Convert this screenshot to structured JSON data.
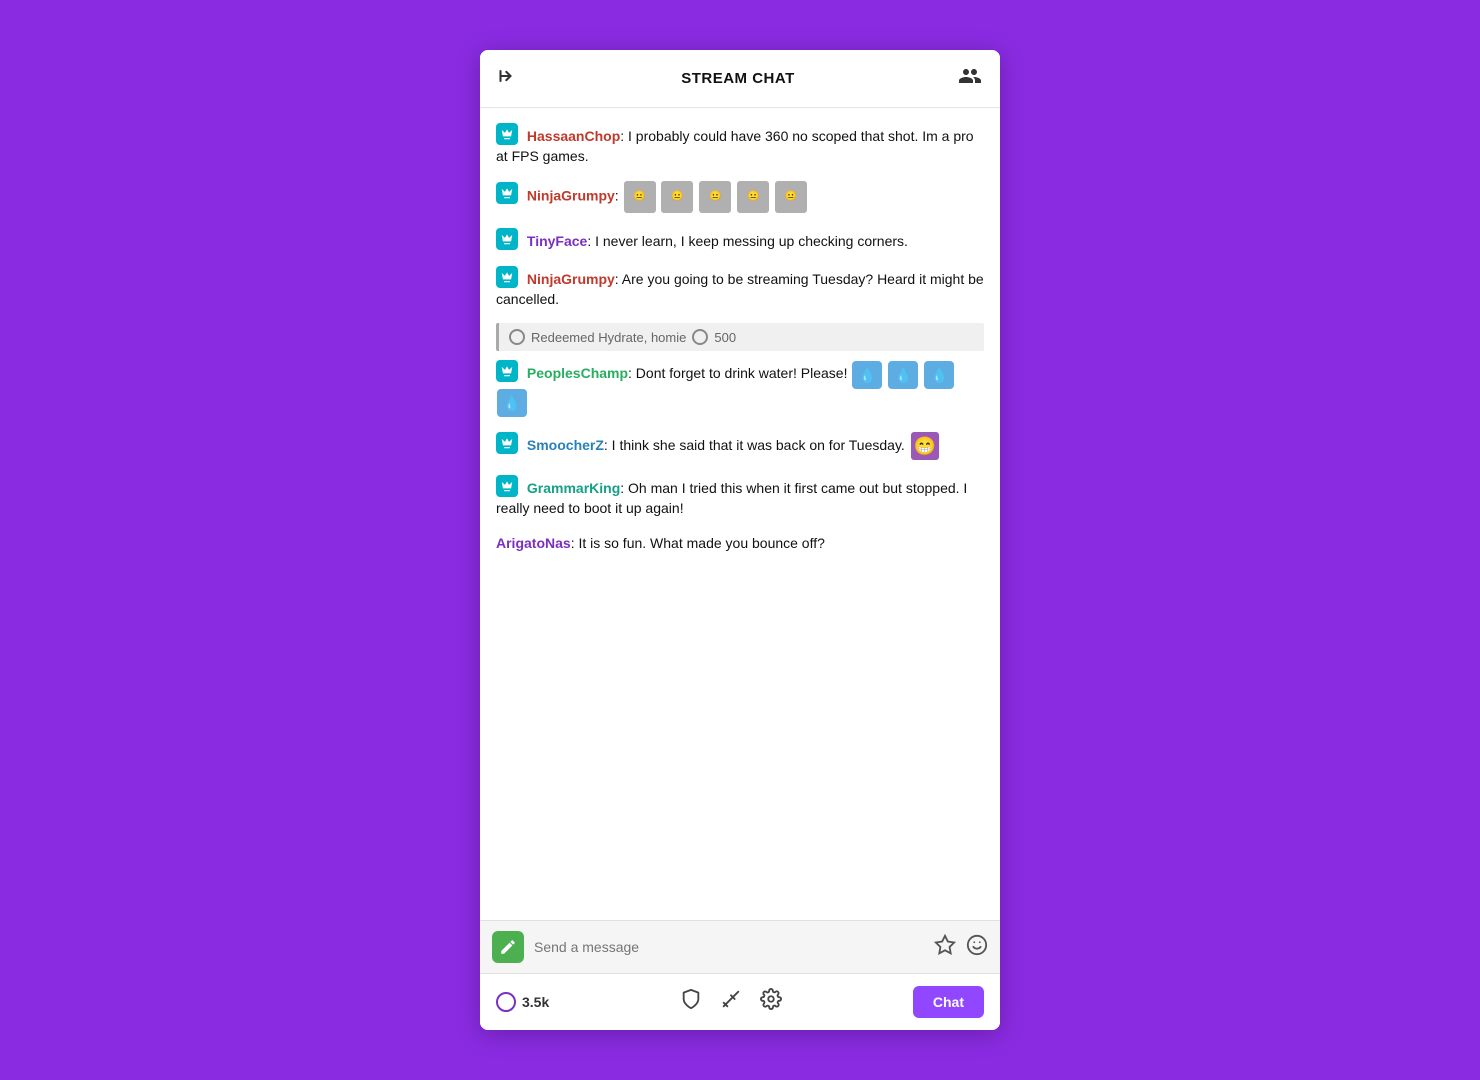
{
  "header": {
    "title": "STREAM CHAT",
    "collapse_label": "collapse",
    "users_label": "users"
  },
  "messages": [
    {
      "id": "msg1",
      "username": "HassaanChop",
      "username_color": "red",
      "has_badge": true,
      "text": ": I probably could have 360 no scoped that shot. Im a pro at FPS games."
    },
    {
      "id": "msg2",
      "username": "NinjaGrumpy",
      "username_color": "red",
      "has_badge": true,
      "text": ":",
      "has_emotes": true,
      "emote_type": "faces"
    },
    {
      "id": "msg3",
      "username": "TinyFace",
      "username_color": "purple",
      "has_badge": true,
      "text": ": I never learn, I keep messing up checking corners."
    },
    {
      "id": "msg4",
      "username": "NinjaGrumpy",
      "username_color": "red",
      "has_badge": true,
      "text": ": Are you going to be streaming Tuesday? Heard it might be cancelled."
    },
    {
      "id": "redemption",
      "type": "redemption",
      "text": "Redeemed Hydrate, homie",
      "points": "500"
    },
    {
      "id": "msg5",
      "username": "PeoplesChamp",
      "username_color": "green",
      "has_badge": true,
      "text": ": Dont forget to drink water! Please!",
      "has_emotes": true,
      "emote_type": "water"
    },
    {
      "id": "msg6",
      "username": "SmoocherZ",
      "username_color": "blue",
      "has_badge": true,
      "text": ": I think she said that it was back on for Tuesday.",
      "has_emotes": true,
      "emote_type": "purple"
    },
    {
      "id": "msg7",
      "username": "GrammarKing",
      "username_color": "teal",
      "has_badge": true,
      "text": ": Oh man I tried this when it first came out but stopped. I really need to boot it up again!"
    },
    {
      "id": "msg8",
      "username": "ArigatoNas",
      "username_color": "purple",
      "has_badge": false,
      "text": ": It is so fun. What made you bounce off?"
    }
  ],
  "input": {
    "placeholder": "Send a message"
  },
  "footer": {
    "viewer_count": "3.5k",
    "chat_button_label": "Chat"
  }
}
